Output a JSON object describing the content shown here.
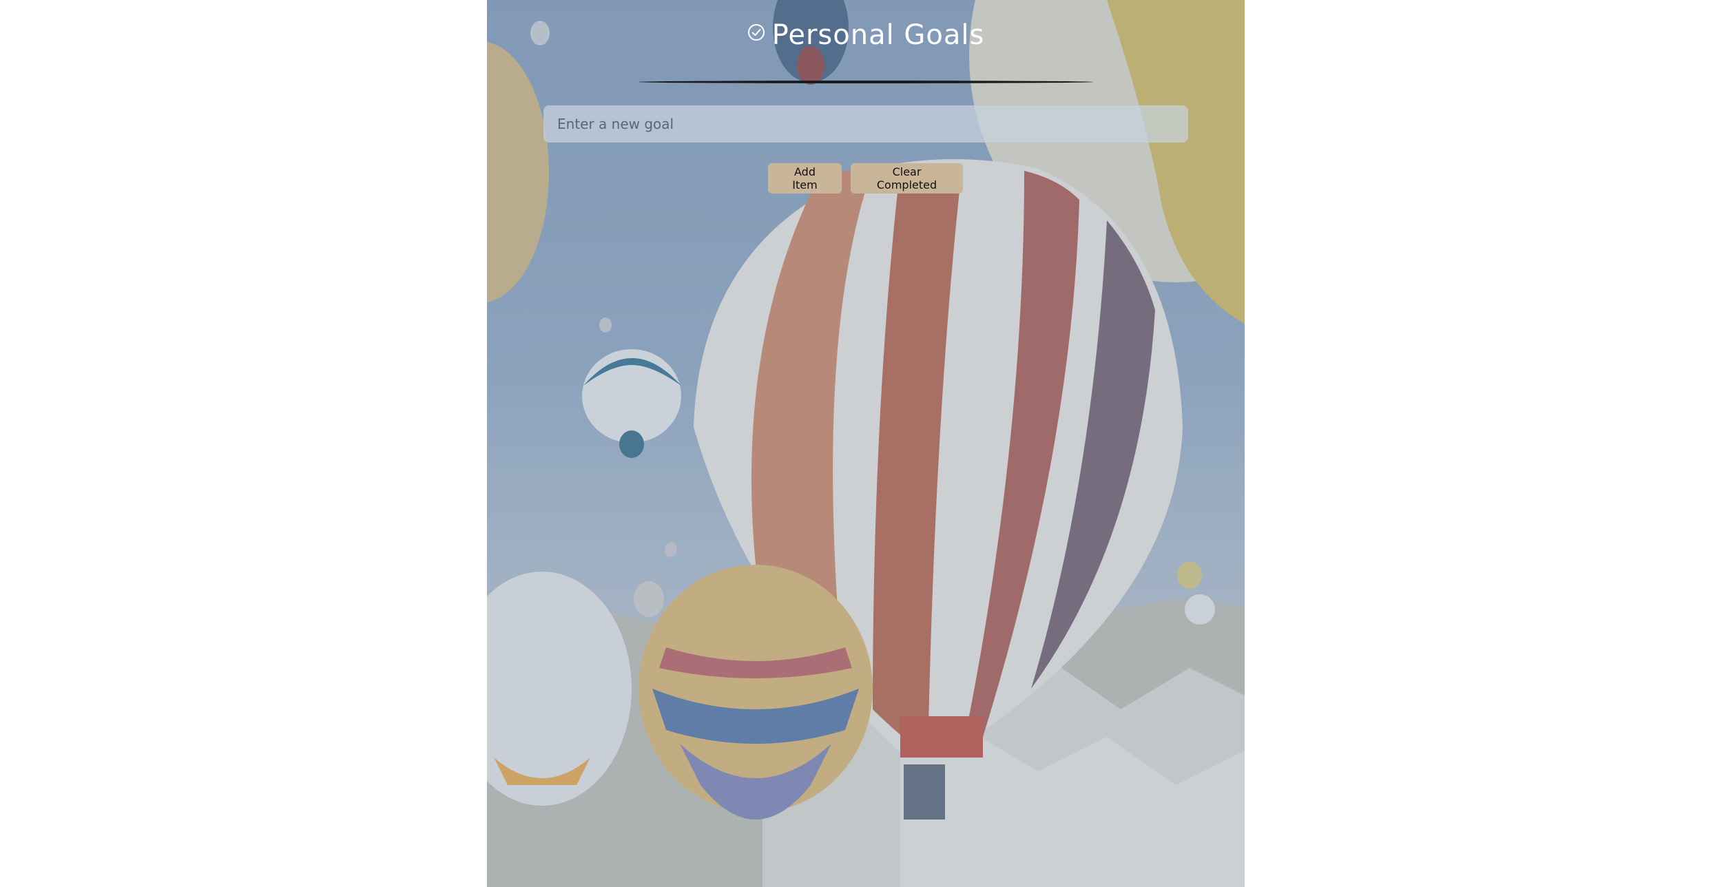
{
  "app": {
    "title": "Personal Goals",
    "title_icon": "check-circle-icon"
  },
  "input": {
    "placeholder": "Enter a new goal",
    "value": ""
  },
  "buttons": {
    "add_label": "Add Item",
    "clear_label": "Clear Completed"
  },
  "colors": {
    "button_bg": "#c9b597",
    "input_bg": "#c8d2de",
    "title_text": "#ffffff"
  }
}
